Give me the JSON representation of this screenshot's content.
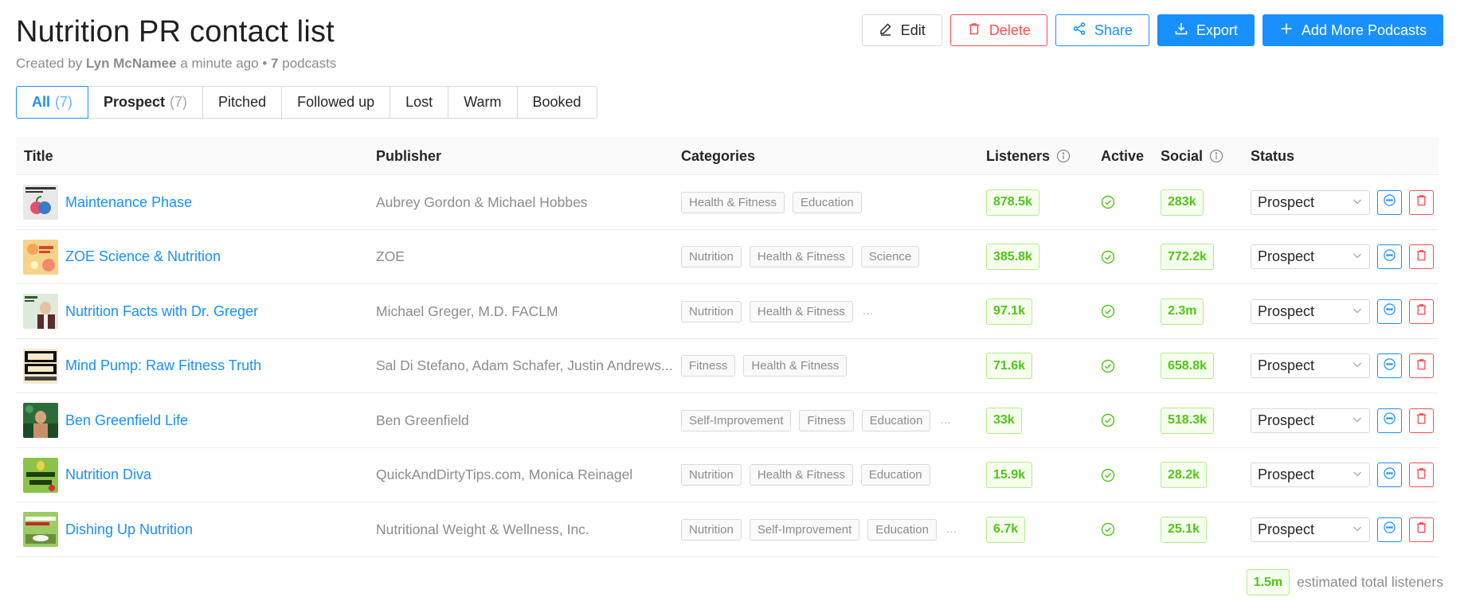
{
  "page": {
    "title": "Nutrition PR contact list",
    "created_by_prefix": "Created by",
    "author": "Lyn McNamee",
    "time_ago": "a minute ago",
    "bullet": "•",
    "podcast_count": "7",
    "podcast_count_suffix": "podcasts"
  },
  "actions": {
    "edit": "Edit",
    "delete": "Delete",
    "share": "Share",
    "export": "Export",
    "add_more": "Add More Podcasts"
  },
  "tabs": [
    {
      "label": "All",
      "count": "(7)"
    },
    {
      "label": "Prospect",
      "count": "(7)"
    },
    {
      "label": "Pitched",
      "count": ""
    },
    {
      "label": "Followed up",
      "count": ""
    },
    {
      "label": "Lost",
      "count": ""
    },
    {
      "label": "Warm",
      "count": ""
    },
    {
      "label": "Booked",
      "count": ""
    }
  ],
  "columns": {
    "title": "Title",
    "publisher": "Publisher",
    "categories": "Categories",
    "listeners": "Listeners",
    "active": "Active",
    "social": "Social",
    "status": "Status"
  },
  "rows": [
    {
      "title": "Maintenance Phase",
      "publisher": "Aubrey Gordon & Michael Hobbes",
      "categories": [
        "Health & Fitness",
        "Education"
      ],
      "more": "",
      "listeners": "878.5k",
      "social": "283k",
      "status": "Prospect",
      "thumb": "maintenance-phase-cover"
    },
    {
      "title": "ZOE Science & Nutrition",
      "publisher": "ZOE",
      "categories": [
        "Nutrition",
        "Health & Fitness",
        "Science"
      ],
      "more": "",
      "listeners": "385.8k",
      "social": "772.2k",
      "status": "Prospect",
      "thumb": "zoe-cover"
    },
    {
      "title": "Nutrition Facts with Dr. Greger",
      "publisher": "Michael Greger, M.D. FACLM",
      "categories": [
        "Nutrition",
        "Health & Fitness"
      ],
      "more": "...",
      "listeners": "97.1k",
      "social": "2.3m",
      "status": "Prospect",
      "thumb": "nutrition-facts-cover"
    },
    {
      "title": "Mind Pump: Raw Fitness Truth",
      "publisher": "Sal Di Stefano, Adam Schafer, Justin Andrews...",
      "categories": [
        "Fitness",
        "Health & Fitness"
      ],
      "more": "",
      "listeners": "71.6k",
      "social": "658.8k",
      "status": "Prospect",
      "thumb": "mind-pump-cover"
    },
    {
      "title": "Ben Greenfield Life",
      "publisher": "Ben Greenfield",
      "categories": [
        "Self-Improvement",
        "Fitness",
        "Education"
      ],
      "more": "...",
      "listeners": "33k",
      "social": "518.3k",
      "status": "Prospect",
      "thumb": "ben-greenfield-cover"
    },
    {
      "title": "Nutrition Diva",
      "publisher": "QuickAndDirtyTips.com, Monica Reinagel",
      "categories": [
        "Nutrition",
        "Health & Fitness",
        "Education"
      ],
      "more": "",
      "listeners": "15.9k",
      "social": "28.2k",
      "status": "Prospect",
      "thumb": "nutrition-diva-cover"
    },
    {
      "title": "Dishing Up Nutrition",
      "publisher": "Nutritional Weight & Wellness, Inc.",
      "categories": [
        "Nutrition",
        "Self-Improvement",
        "Education"
      ],
      "more": "...",
      "listeners": "6.7k",
      "social": "25.1k",
      "status": "Prospect",
      "thumb": "dishing-up-nutrition-cover"
    }
  ],
  "footer": {
    "total": "1.5m",
    "label": "estimated total listeners"
  },
  "colors": {
    "primary": "#1890ff",
    "danger": "#ff4d4f",
    "success": "#52c41a"
  }
}
